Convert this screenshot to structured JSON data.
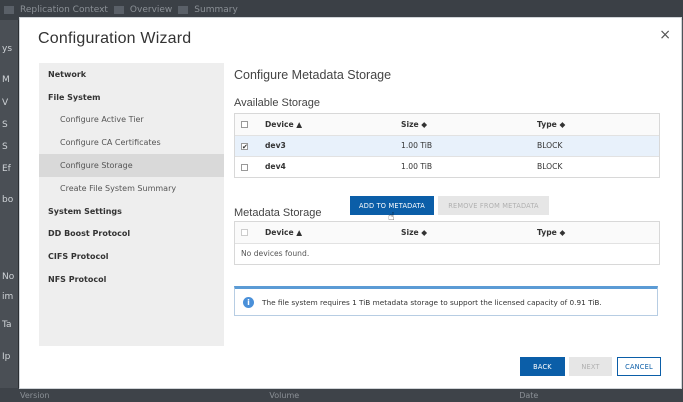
{
  "background": {
    "tabs": [
      "Replication Context",
      "Overview",
      "Summary"
    ],
    "left_letters": [
      "ys",
      "M",
      "V",
      "S",
      "S",
      "Ef",
      "bo",
      "No",
      "im",
      "Ta",
      "Ip"
    ],
    "bottom": [
      "Version",
      "Volume",
      "Date"
    ]
  },
  "modal": {
    "title": "Configuration Wizard",
    "close_label": "×",
    "sidebar": [
      {
        "label": "Network",
        "level": "top"
      },
      {
        "label": "File System",
        "level": "top"
      },
      {
        "label": "Configure Active Tier",
        "level": "sub"
      },
      {
        "label": "Configure CA Certificates",
        "level": "sub"
      },
      {
        "label": "Configure Storage",
        "level": "sub",
        "active": true
      },
      {
        "label": "Create File System Summary",
        "level": "sub"
      },
      {
        "label": "System Settings",
        "level": "top"
      },
      {
        "label": "DD Boost Protocol",
        "level": "top"
      },
      {
        "label": "CIFS Protocol",
        "level": "top"
      },
      {
        "label": "NFS Protocol",
        "level": "top"
      }
    ],
    "main": {
      "heading": "Configure Metadata Storage",
      "available": {
        "title": "Available Storage",
        "headers": [
          "Device ▲",
          "Size ◆",
          "Type ◆"
        ],
        "rows": [
          {
            "device": "dev3",
            "size": "1.00 TiB",
            "type": "BLOCK",
            "checked": true
          },
          {
            "device": "dev4",
            "size": "1.00 TiB",
            "type": "BLOCK",
            "checked": false
          }
        ]
      },
      "add_button": "ADD TO METADATA",
      "remove_button": "REMOVE FROM METADATA",
      "metadata": {
        "title": "Metadata Storage",
        "headers": [
          "Device ▲",
          "Size ◆",
          "Type ◆"
        ],
        "empty_text": "No devices found."
      },
      "info_icon": "i",
      "info_text": "The file system requires 1 TiB metadata storage to support the licensed capacity of 0.91 TiB."
    },
    "footer": {
      "back": "BACK",
      "next": "NEXT",
      "cancel": "CANCEL"
    },
    "checkmark": "✔",
    "cursor": "☝"
  },
  "colors": {
    "primary": "#0b5ea8",
    "selected_row": "#e8f1fb",
    "sidebar_bg": "#eeeeee",
    "info_accent": "#5b9bd5"
  }
}
